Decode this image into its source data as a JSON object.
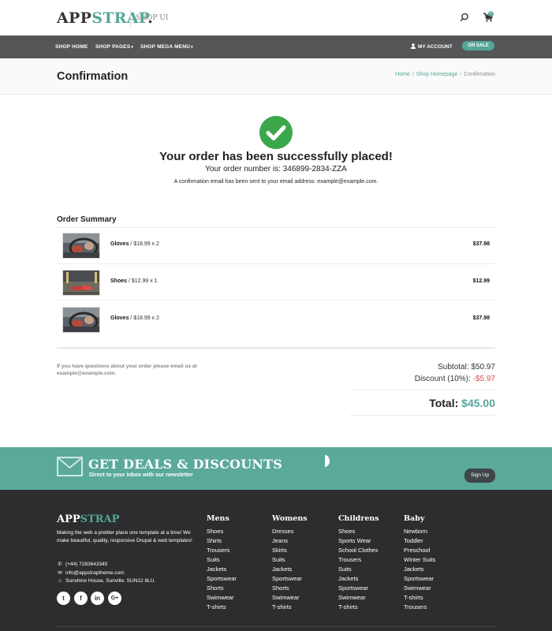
{
  "header": {
    "logo_app": "APP",
    "logo_strap": "STRAP",
    "logo_dot": ".",
    "tagline": "SHOP UI",
    "cart_count": "0"
  },
  "nav": {
    "items": [
      {
        "label": "SHOP HOME"
      },
      {
        "label": "SHOP PAGES"
      },
      {
        "label": "SHOP MEGA MENU"
      }
    ],
    "account": "MY ACCOUNT",
    "on_sale": "ON SALE"
  },
  "page": {
    "title": "Confirmation",
    "breadcrumb": [
      "Home",
      "Shop Homepage",
      "Confirmation"
    ],
    "breadcrumb_sep": "/"
  },
  "confirmation": {
    "heading": "Your order has been successfully placed!",
    "order_number": "Your order number is: 346899-2834-ZZA",
    "email_note": "A confirmation email has been sent to your email address: example@example.com."
  },
  "order_summary": {
    "title": "Order Summary",
    "items": [
      {
        "name": "Gloves",
        "detail": " / $18.99 x 2",
        "total": "$37.98"
      },
      {
        "name": "Shoes",
        "detail": " / $12.99 x 1",
        "total": "$12.99"
      },
      {
        "name": "Gloves",
        "detail": " / $18.99 x 2",
        "total": "$37.98"
      }
    ],
    "questions": "If you have questions about your order please email us at example@example.com.",
    "subtotal_label": "Subtotal:",
    "subtotal_value": "$50.97",
    "discount_label": "Discount (10%):",
    "discount_value": "-$5.97",
    "total_label": "Total:",
    "total_value": "$45.00"
  },
  "deals": {
    "heading": "GET DEALS & DISCOUNTS",
    "subheading": "Direct to your inbox with our newsletter",
    "signup": "Sign Up"
  },
  "footer": {
    "logo_app": "APP",
    "logo_strap": "STRAP",
    "about": "Making the web a prettier place one template at a time! We make beautiful, quality, responsive Drupal & web templates!",
    "phone": "(+44) 7283643345",
    "email": "info@appstraptheme.com",
    "address": "Sunshine House, Sunville. SUN12 8LU.",
    "social": [
      "twitter-icon",
      "facebook-icon",
      "linkedin-icon",
      "google-plus-icon"
    ],
    "columns": [
      {
        "title": "Mens",
        "links": [
          "Shoes",
          "Shirts",
          "Trousers",
          "Suits",
          "Jackets",
          "Sportswear",
          "Shorts",
          "Swimwear",
          "T-shirts"
        ]
      },
      {
        "title": "Womens",
        "links": [
          "Dresses",
          "Jeans",
          "Skirts",
          "Suits",
          "Jackets",
          "Sportswear",
          "Shorts",
          "Swimwear",
          "T-shirts"
        ]
      },
      {
        "title": "Childrens",
        "links": [
          "Shoes",
          "Sports Wear",
          "School Clothes",
          "Trousers",
          "Suits",
          "Jackets",
          "Sportswear",
          "Swimwear",
          "T-shirts"
        ]
      },
      {
        "title": "Baby",
        "links": [
          "Newborn",
          "Toddler",
          "Preschool",
          "Winter Suits",
          "Jackets",
          "Sportswear",
          "Swimwear",
          "T-shirts",
          "Trousers"
        ]
      }
    ]
  },
  "colors": {
    "accent": "#55a699",
    "nav_bg": "#555657",
    "footer_bg": "#2c2d2f",
    "success": "#3aa84a",
    "discount": "#d9534f"
  }
}
